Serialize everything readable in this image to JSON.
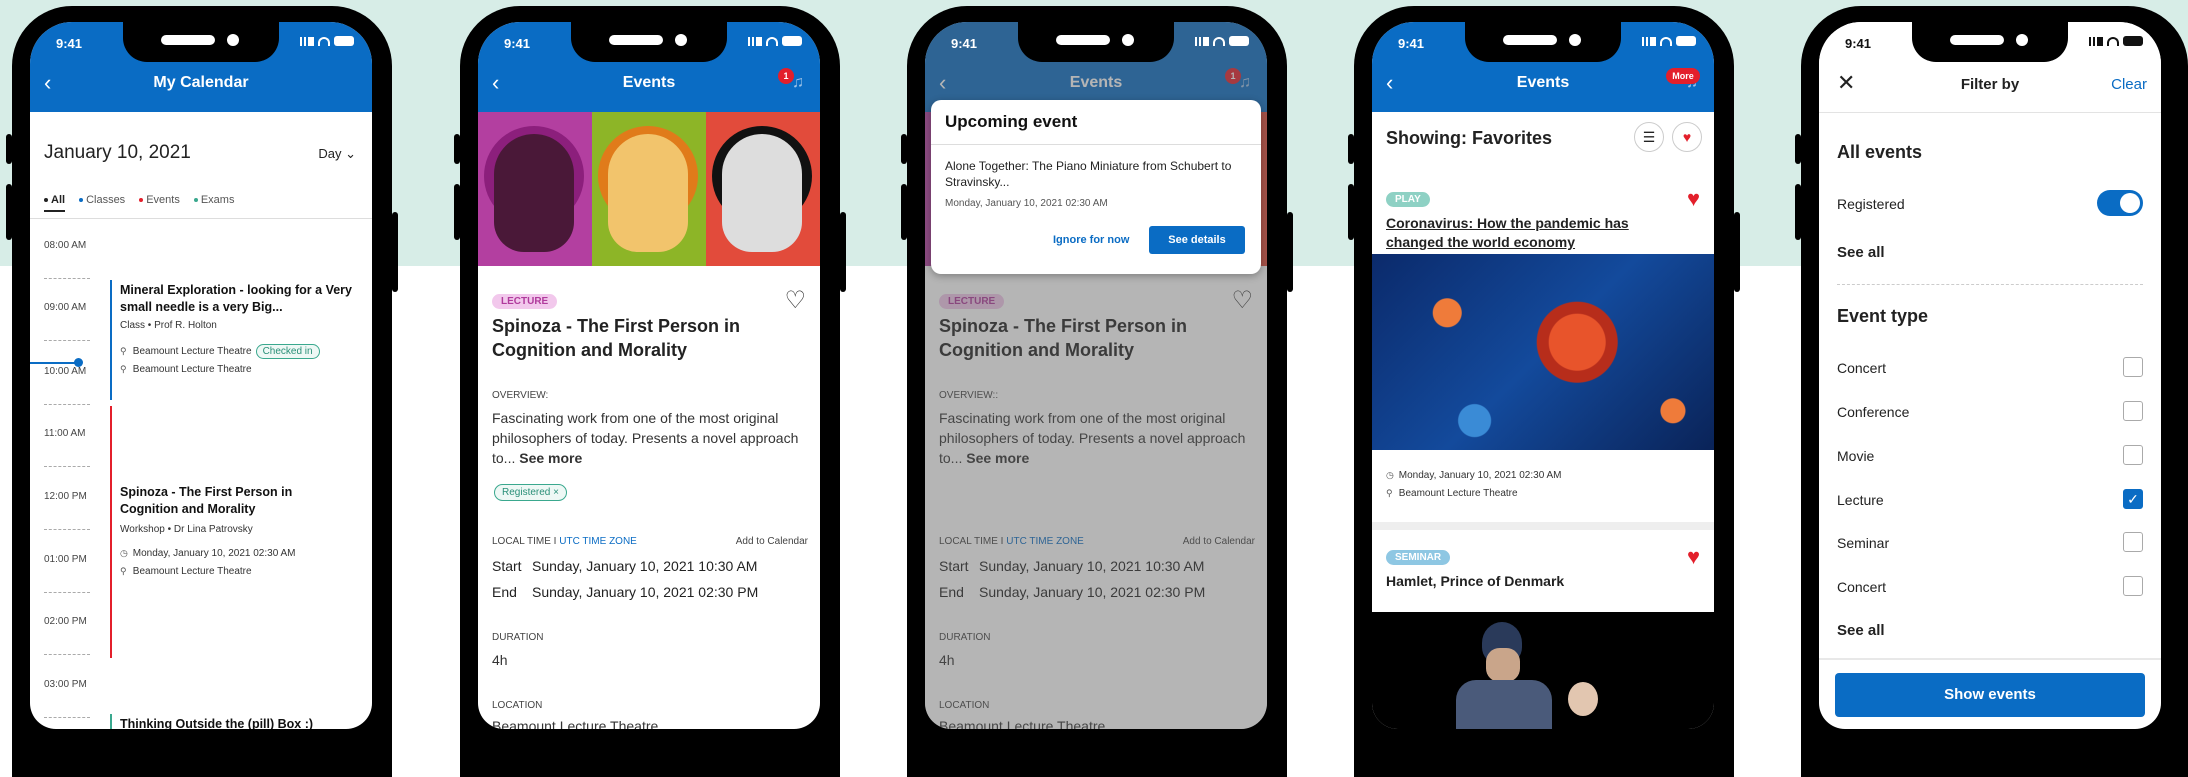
{
  "status": {
    "time": "9:41"
  },
  "calendar": {
    "title": "My Calendar",
    "date": "January 10, 2021",
    "view": "Day",
    "tabs": [
      {
        "label": "All",
        "color": "#222222"
      },
      {
        "label": "Classes",
        "color": "#0a6cc4"
      },
      {
        "label": "Events",
        "color": "#e31f2b"
      },
      {
        "label": "Exams",
        "color": "#3aa88e"
      }
    ],
    "hours": [
      "08:00 AM",
      "09:00 AM",
      "10:00 AM",
      "11:00 AM",
      "12:00 PM",
      "01:00 PM",
      "02:00 PM",
      "03:00 PM"
    ],
    "ev1": {
      "title": "Mineral Exploration - looking for a Very small needle is a very Big...",
      "sub": "Class • Prof R. Holton",
      "loc1": "Beamount Lecture Theatre",
      "chip": "Checked in",
      "loc2": "Beamount Lecture Theatre"
    },
    "ev2": {
      "title": "Spinoza - The First Person in Cognition and Morality",
      "sub": "Workshop • Dr Lina Patrovsky",
      "date": "Monday, January 10, 2021 02:30 AM",
      "loc": "Beamount Lecture Theatre"
    },
    "ev3": {
      "title": "Thinking Outside the (pill) Box :)"
    }
  },
  "event": {
    "title_bar": "Events",
    "badge": "1",
    "category": "LECTURE",
    "title": "Spinoza - The First Person in Cognition and Morality",
    "overview_label": "OVERVIEW:",
    "overview_label_dim": "OVERVIEW::",
    "overview": "Fascinating work from one of the most original philosophers of today. Presents a novel approach to...",
    "see_more": "See more",
    "registered": "Registered",
    "local_time": "LOCAL TIME I",
    "utc": "UTC TIME ZONE",
    "add_cal": "Add to Calendar",
    "start_label": "Start",
    "start": "Sunday, January 10, 2021 10:30 AM",
    "end_label": "End",
    "end": "Sunday, January 10, 2021 02:30 PM",
    "duration_label": "DURATION",
    "duration": "4h",
    "location_label": "LOCATION",
    "location": "Beamount Lecture Theatre"
  },
  "popup": {
    "heading": "Upcoming event",
    "body": "Alone Together: The Piano Miniature from Schubert to Stravinsky...",
    "date": "Monday, January 10, 2021 02:30 AM",
    "ignore": "Ignore for now",
    "see": "See details"
  },
  "favorites": {
    "title_bar": "Events",
    "badge": "More",
    "heading": "Showing: Favorites",
    "card1": {
      "chip": "PLAY",
      "title": "Coronavirus: How the pandemic has changed the world economy",
      "date": "Monday, January 10, 2021 02:30 AM",
      "loc": "Beamount Lecture Theatre"
    },
    "card2": {
      "chip": "SEMINAR",
      "title": "Hamlet, Prince of Denmark"
    }
  },
  "filter": {
    "title": "Filter by",
    "clear": "Clear",
    "all_events": "All events",
    "registered": "Registered",
    "see_all": "See all",
    "event_type": "Event type",
    "types": [
      {
        "label": "Concert",
        "checked": false
      },
      {
        "label": "Conference",
        "checked": false
      },
      {
        "label": "Movie",
        "checked": false
      },
      {
        "label": "Lecture",
        "checked": true
      },
      {
        "label": "Seminar",
        "checked": false
      },
      {
        "label": "Concert",
        "checked": false
      }
    ],
    "see_all2": "See all",
    "show": "Show events"
  }
}
